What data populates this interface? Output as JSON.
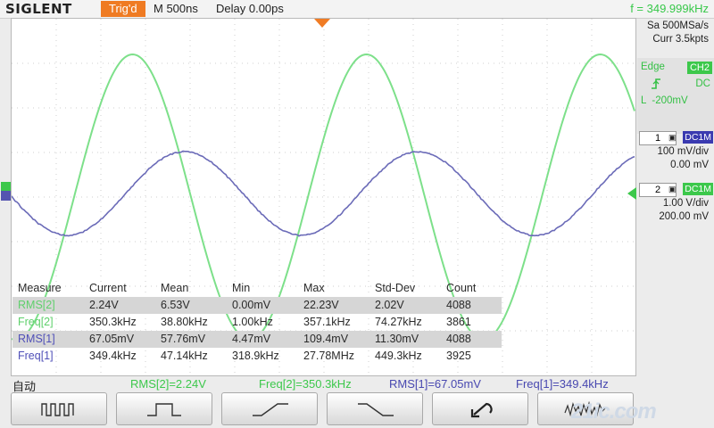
{
  "header": {
    "brand": "SIGLENT",
    "trigger_status": "Trig'd",
    "timebase": "M 500ns",
    "delay": "Delay 0.00ps",
    "frequency": "f = 349.999kHz"
  },
  "acquisition": {
    "sample_rate": "Sa 500MSa/s",
    "memory_depth": "Curr 3.5kpts"
  },
  "trigger": {
    "type": "Edge",
    "source": "CH2",
    "slope_icon": "rising-edge-icon",
    "coupling": "DC",
    "level": "L  -200mV"
  },
  "channels": [
    {
      "number": "1",
      "coupling": "DC1M",
      "scale": "100 mV/div",
      "offset": "0.00 mV",
      "color": "#6b6bb8"
    },
    {
      "number": "2",
      "coupling": "DC1M",
      "scale": "1.00 V/div",
      "offset": "200.00 mV",
      "color": "#7de08a"
    }
  ],
  "measurements": {
    "headers": [
      "Measure",
      "Current",
      "Mean",
      "Min",
      "Max",
      "Std-Dev",
      "Count"
    ],
    "rows": [
      [
        "RMS[2]",
        "2.24V",
        "6.53V",
        "0.00mV",
        "22.23V",
        "2.02V",
        "4088"
      ],
      [
        "Freq[2]",
        "350.3kHz",
        "38.80kHz",
        "1.00kHz",
        "357.1kHz",
        "74.27kHz",
        "3861"
      ],
      [
        "RMS[1]",
        "67.05mV",
        "57.76mV",
        "4.47mV",
        "109.4mV",
        "11.30mV",
        "4088"
      ],
      [
        "Freq[1]",
        "349.4kHz",
        "47.14kHz",
        "318.9kHz",
        "27.78MHz",
        "449.3kHz",
        "3925"
      ]
    ]
  },
  "status_bar": {
    "mode": "自动",
    "items": [
      "RMS[2]=2.24V",
      "Freq[2]=350.3kHz",
      "RMS[1]=67.05mV",
      "Freq[1]=349.4kHz"
    ]
  },
  "softkeys": [
    "square-wave-icon",
    "pulse-icon",
    "rising-ramp-icon",
    "falling-ramp-icon",
    "undo-icon",
    "noise-wave-icon"
  ],
  "colors": {
    "ch1": "#6b6bb8",
    "ch2": "#7de08a",
    "trigger": "#f07c24",
    "accent": "#3cc84b"
  }
}
